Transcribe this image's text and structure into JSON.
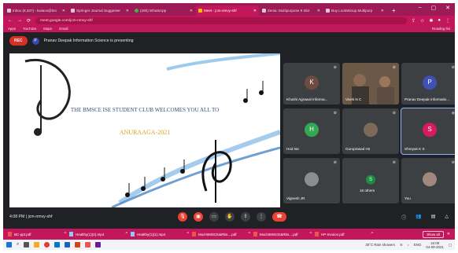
{
  "browser": {
    "tabs": [
      {
        "label": "Inbox (8,337) - kwiacs@bm",
        "active": false
      },
      {
        "label": "Springer Journal Suggester",
        "active": false
      },
      {
        "label": "(280) WhatsApp",
        "active": false
      },
      {
        "label": "Meet - jcm-nmvy-shf",
        "active": true
      },
      {
        "label": "Zenia: Multipurpose 9 Slot",
        "active": false
      },
      {
        "label": "Buy LookWinup Multipurp",
        "active": false
      }
    ],
    "url": "meet.google.com/jcm-nmvy-shf",
    "bookmarks": [
      "Apps",
      "YouTube",
      "Maps",
      "Gmail"
    ],
    "reading_list": "Reading list"
  },
  "meet": {
    "rec_label": "REC",
    "presenter_initial": "P",
    "presenting_text": "Pranav Deepak Information Science is presenting",
    "slide": {
      "title": "THE BMSCE ISE STUDENT CLUB WELCOMES YOU ALL TO",
      "subtitle": "ANURAAGA-2021"
    },
    "participants": [
      {
        "name": "Khushi Agrawal Informa...",
        "initial": "K",
        "color": "#6d4c41"
      },
      {
        "name": "Vivek N C",
        "initial": "",
        "color": "#5f4b3b"
      },
      {
        "name": "Pranav Deepak Informatio...",
        "initial": "P",
        "color": "#3f51b5"
      },
      {
        "name": "Hod Ise",
        "initial": "H",
        "color": "#33a853"
      },
      {
        "name": "Guruprasad Hs",
        "initial": "",
        "color": "#7b6a58"
      },
      {
        "name": "Shreyas K S",
        "initial": "S",
        "color": "#d81b60"
      },
      {
        "name": "Vignesh JR",
        "initial": "",
        "color": "#8d8d8d"
      },
      {
        "name": "16 others",
        "initial": "S",
        "color": "#1e8e3e"
      },
      {
        "name": "You",
        "initial": "",
        "color": "#a1887f"
      }
    ],
    "time": "4:08 PM",
    "meeting_code": "jcm-nmvy-shf"
  },
  "downloads": [
    "BC-ppt.pdf",
    "Healthy(1)(2).mp4",
    "Healthy(1)(1).mp4",
    "Mod-BMSCE&Rbs....pdf",
    "Mod-BMSCE&Rbs....pdf",
    "HP-Invoice.pdf"
  ],
  "show_all": "Show all",
  "taskbar": {
    "weather": "30°C Rain showers",
    "lang": "ENG",
    "time": "16:08",
    "date": "04-09-2021"
  }
}
